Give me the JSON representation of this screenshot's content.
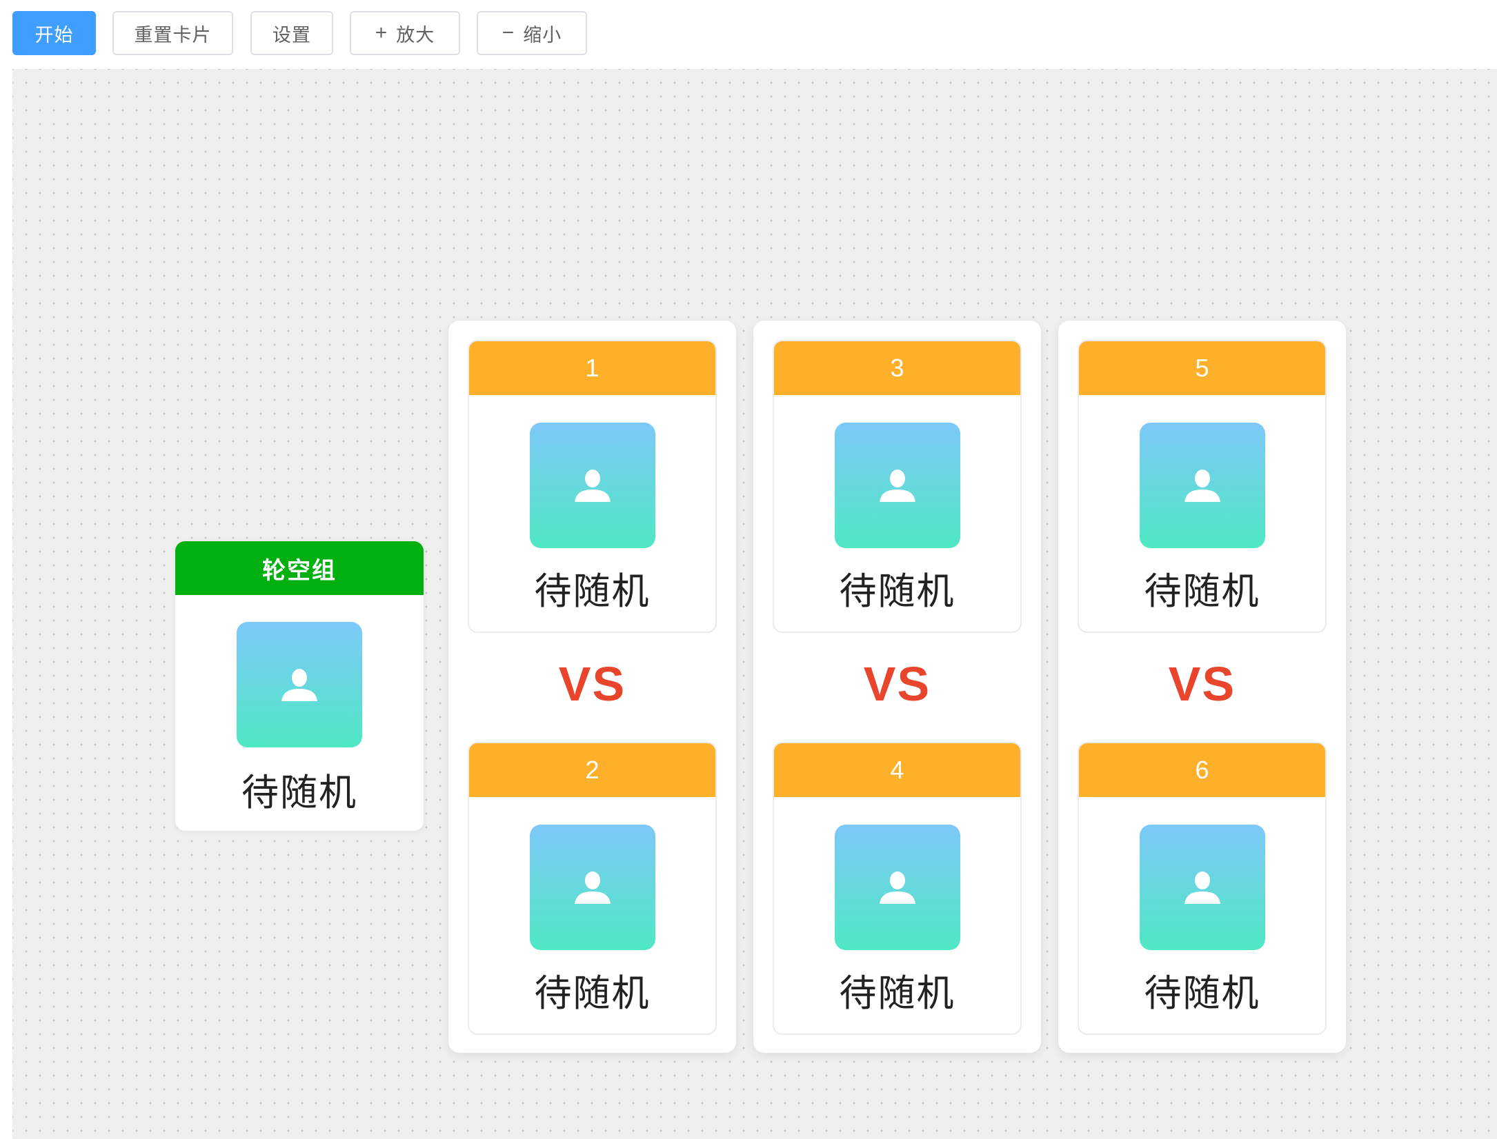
{
  "toolbar": {
    "start_label": "开始",
    "reset_label": "重置卡片",
    "settings_label": "设置",
    "zoom_in_icon": "plus-icon",
    "zoom_in_label": "放大",
    "zoom_out_icon": "minus-icon",
    "zoom_out_label": "缩小"
  },
  "bye": {
    "title": "轮空组",
    "name": "待随机",
    "header_color": "#00b010"
  },
  "matches": [
    {
      "top": {
        "seat": "1",
        "name": "待随机"
      },
      "vs": "VS",
      "bottom": {
        "seat": "2",
        "name": "待随机"
      }
    },
    {
      "top": {
        "seat": "3",
        "name": "待随机"
      },
      "vs": "VS",
      "bottom": {
        "seat": "4",
        "name": "待随机"
      }
    },
    {
      "top": {
        "seat": "5",
        "name": "待随机"
      },
      "vs": "VS",
      "bottom": {
        "seat": "6",
        "name": "待随机"
      }
    }
  ],
  "colors": {
    "primary": "#409eff",
    "seat_header": "#ffb02a",
    "vs_text": "#e8452c",
    "avatar_gradient_top": "#7dc8f8",
    "avatar_gradient_bottom": "#4fe8c3"
  }
}
